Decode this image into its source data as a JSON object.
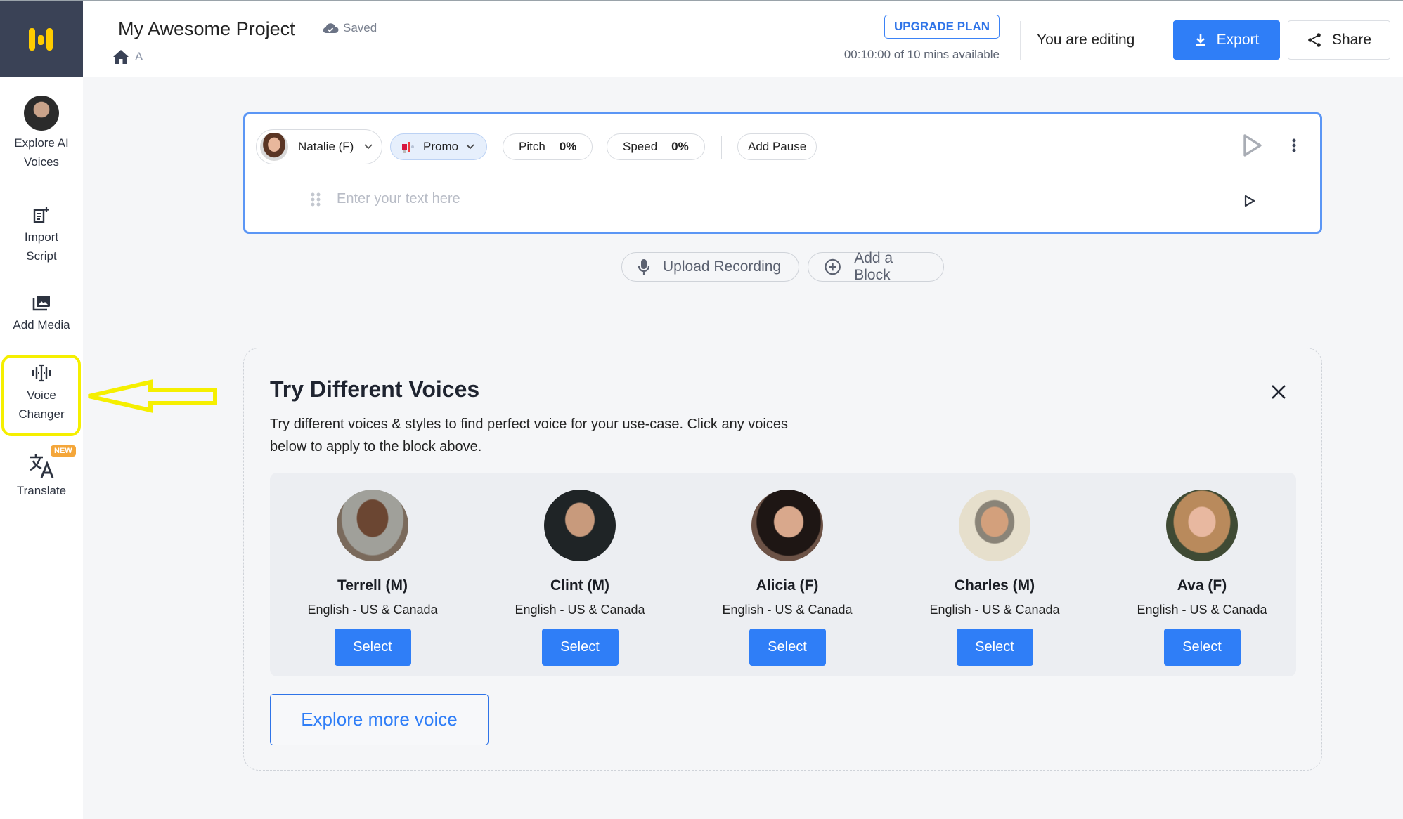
{
  "header": {
    "project_title": "My Awesome Project",
    "save_status": "Saved",
    "breadcrumb_current": "A",
    "upgrade_label": "UPGRADE PLAN",
    "minutes_available": "00:10:00 of 10 mins available",
    "editing_status": "You are editing",
    "export_label": "Export",
    "share_label": "Share"
  },
  "sidebar": {
    "items": [
      {
        "label_line1": "Explore AI",
        "label_line2": "Voices",
        "icon": "avatar"
      },
      {
        "label_line1": "Import",
        "label_line2": "Script",
        "icon": "import-script-icon"
      },
      {
        "label_line1": "Add Media",
        "label_line2": "",
        "icon": "add-media-icon"
      },
      {
        "label_line1": "Voice",
        "label_line2": "Changer",
        "icon": "voice-changer-icon",
        "highlighted": true
      },
      {
        "label_line1": "Translate",
        "label_line2": "",
        "icon": "translate-icon",
        "badge": "NEW"
      }
    ]
  },
  "editor": {
    "voice": "Natalie (F)",
    "style": "Promo",
    "pitch_label": "Pitch",
    "pitch_value": "0%",
    "speed_label": "Speed",
    "speed_value": "0%",
    "add_pause_label": "Add Pause",
    "text_placeholder": "Enter your text here",
    "text_value": ""
  },
  "actions": {
    "upload_label": "Upload Recording",
    "add_block_label": "Add a Block"
  },
  "try_voices": {
    "title": "Try Different Voices",
    "description": "Try different voices & styles to find perfect voice for your use-case. Click any voices below to apply to the block above.",
    "voices": [
      {
        "name": "Terrell (M)",
        "language": "English - US & Canada",
        "select_label": "Select"
      },
      {
        "name": "Clint (M)",
        "language": "English - US & Canada",
        "select_label": "Select"
      },
      {
        "name": "Alicia (F)",
        "language": "English - US & Canada",
        "select_label": "Select"
      },
      {
        "name": "Charles (M)",
        "language": "English - US & Canada",
        "select_label": "Select"
      },
      {
        "name": "Ava (F)",
        "language": "English - US & Canada",
        "select_label": "Select"
      }
    ],
    "explore_more_label": "Explore more voice"
  },
  "colors": {
    "accent": "#2f7ef7",
    "logo_yellow": "#ffcc00",
    "annotation_yellow": "#f5ef00",
    "sidebar_dark": "#3a4256",
    "new_badge": "#f4a63a"
  }
}
